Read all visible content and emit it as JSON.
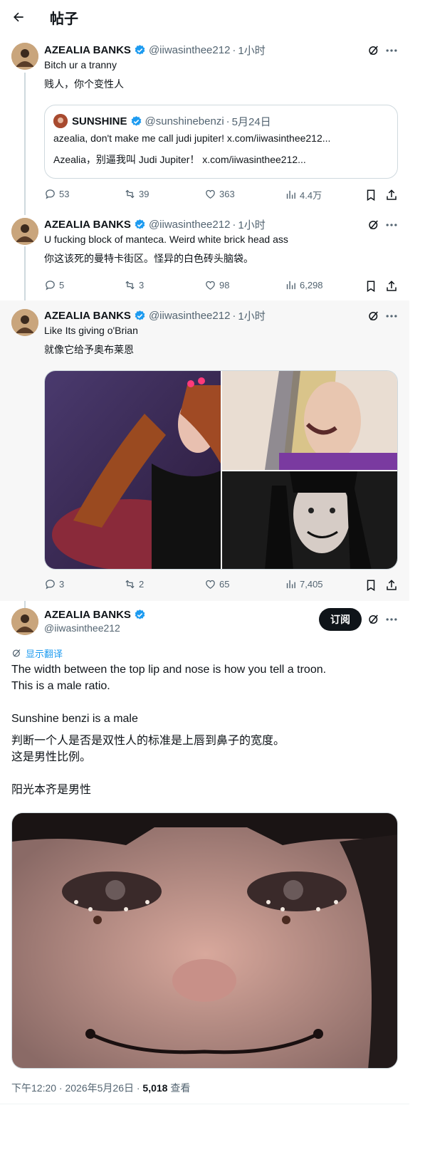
{
  "header": {
    "title": "帖子"
  },
  "tweets": [
    {
      "name": "AZEALIA BANKS",
      "handle": "@iiwasinthee212",
      "time": "1小时",
      "text": "Bitch ur a tranny",
      "translation": "贱人，你个变性人",
      "quote": {
        "name": "SUNSHINE",
        "handle": "@sunshinebenzi",
        "time": "5月24日",
        "text": "azealia, don't make me call judi jupiter! x.com/iiwasinthee212...",
        "translation": "Azealia，别逼我叫 Judi Jupiter！ x.com/iiwasinthee212..."
      },
      "stats": {
        "replies": "53",
        "retweets": "39",
        "likes": "363",
        "views": "4.4万"
      }
    },
    {
      "name": "AZEALIA BANKS",
      "handle": "@iiwasinthee212",
      "time": "1小时",
      "text": "U fucking block of manteca. Weird white brick head ass",
      "translation": "你这该死的曼特卡街区。怪异的白色砖头脑袋。",
      "stats": {
        "replies": "5",
        "retweets": "3",
        "likes": "98",
        "views": "6,298"
      }
    },
    {
      "name": "AZEALIA BANKS",
      "handle": "@iiwasinthee212",
      "time": "1小时",
      "text": "Like Its giving o'Brian",
      "translation": "就像它给予奥布莱恩",
      "stats": {
        "replies": "3",
        "retweets": "2",
        "likes": "65",
        "views": "7,405"
      }
    }
  ],
  "main": {
    "name": "AZEALIA BANKS",
    "handle": "@iiwasinthee212",
    "subscribe": "订阅",
    "show_translation": "显示翻译",
    "text": "The width between the top lip and nose is how you tell a troon.\nThis is a male ratio.\n\nSunshine benzi is a male",
    "translation": "判断一个人是否是双性人的标准是上唇到鼻子的宽度。\n这是男性比例。\n\n阳光本齐是男性",
    "meta_time": "下午12:20 · 2026年5月26日 · ",
    "meta_views": "5,018",
    "meta_views_label": " 查看"
  },
  "colors": {
    "accent": "#1d9bf0",
    "text": "#0f1419",
    "muted": "#536471",
    "highlight_bg": "#f7f7f7"
  }
}
